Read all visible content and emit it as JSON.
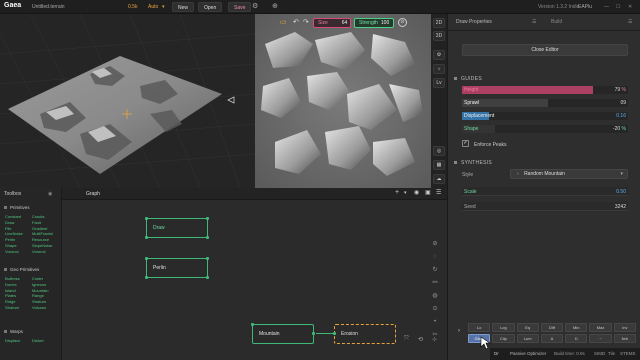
{
  "topbar": {
    "app_name": "Gaea",
    "file_name": "Untitled.terrain",
    "resolution": "0.5k",
    "build_mode": "Auto",
    "new_label": "New",
    "open_label": "Open",
    "save_label": "Save",
    "version": "Version 1.3.2 Indie",
    "user": "EAPlu",
    "console_label": "Console"
  },
  "viewport": {
    "mode_2d": "2D",
    "mode_3d": "3D",
    "lv_label": "Lv"
  },
  "brush": {
    "size_label": "Size",
    "size_value": "64",
    "strength_label": "Strength",
    "strength_value": "100"
  },
  "panel": {
    "tab_properties": "Draw Properties",
    "tab_build": "Build",
    "close_editor": "Close Editor",
    "guides_title": "GUIDES",
    "synthesis_title": "SYNTHESIS",
    "sliders": [
      {
        "label": "Height",
        "value": "79",
        "unit": "%",
        "fill_fraction": 0.79,
        "color": "#d94a78"
      },
      {
        "label": "Sprawl",
        "value": "09",
        "unit": "",
        "fill_fraction": 0.52,
        "color": "#4a4a4a"
      },
      {
        "label": "Displacement",
        "value": "0.16",
        "unit": "",
        "fill_fraction": 0.16,
        "color": "#3a8fd6"
      },
      {
        "label": "Shape",
        "value": "-20",
        "unit": "%",
        "fill_fraction": 0.2,
        "color": "#3a3a3a"
      }
    ],
    "enforce_peaks": "Enforce Peaks",
    "style_label": "Style",
    "style_value": "Random Mountain",
    "scale_label": "Scale",
    "scale_value": "0.50",
    "seed_label": "Seed",
    "seed_value": "3242",
    "ops_row1": [
      "Lo",
      "Log",
      "Eq",
      "Diff",
      "Min",
      "Max",
      "Inv"
    ],
    "ops_row2": [
      "Glow",
      "Clip",
      "Lum",
      "A",
      "D",
      "~",
      "Nrb"
    ],
    "ops_row2_active": "Glow"
  },
  "status": {
    "optimizer": "Passive Optimizer",
    "build_time": "Build time: 0.0s",
    "simd": "SIMD",
    "tile": "Tile",
    "stems": "STEMS"
  },
  "toolbox": {
    "title": "Toolbox",
    "primitives_title": "Primitives",
    "primitives": [
      "Constant",
      "Cracks",
      "Draw",
      "Fault",
      "File",
      "Gradient",
      "LineNoise",
      "MultiFractal",
      "Perlin",
      "Resource",
      "Shape",
      "SlopeNoise",
      "Voronoi",
      "Voronoi"
    ],
    "geo_title": "Geo Primitives",
    "geo": [
      "Buttress",
      "Crater",
      "Dunes",
      "Igneous",
      "Island",
      "Mountain",
      "Plates",
      "Range",
      "Ridge",
      "Stratum",
      "Stratum",
      "Volcano"
    ],
    "warps_title": "Warps",
    "warps": [
      "Displace",
      "Distort"
    ]
  },
  "graph": {
    "tab_label": "Graph",
    "nodes": {
      "draw": "Draw",
      "perlin": "Perlin",
      "mountain": "Mountain",
      "erosion": "Erosion"
    }
  },
  "colors": {
    "accent_pink": "#d94a78",
    "accent_green": "#3fb879",
    "accent_orange": "#e8a33d",
    "panel_bg": "#2e2e2e"
  }
}
